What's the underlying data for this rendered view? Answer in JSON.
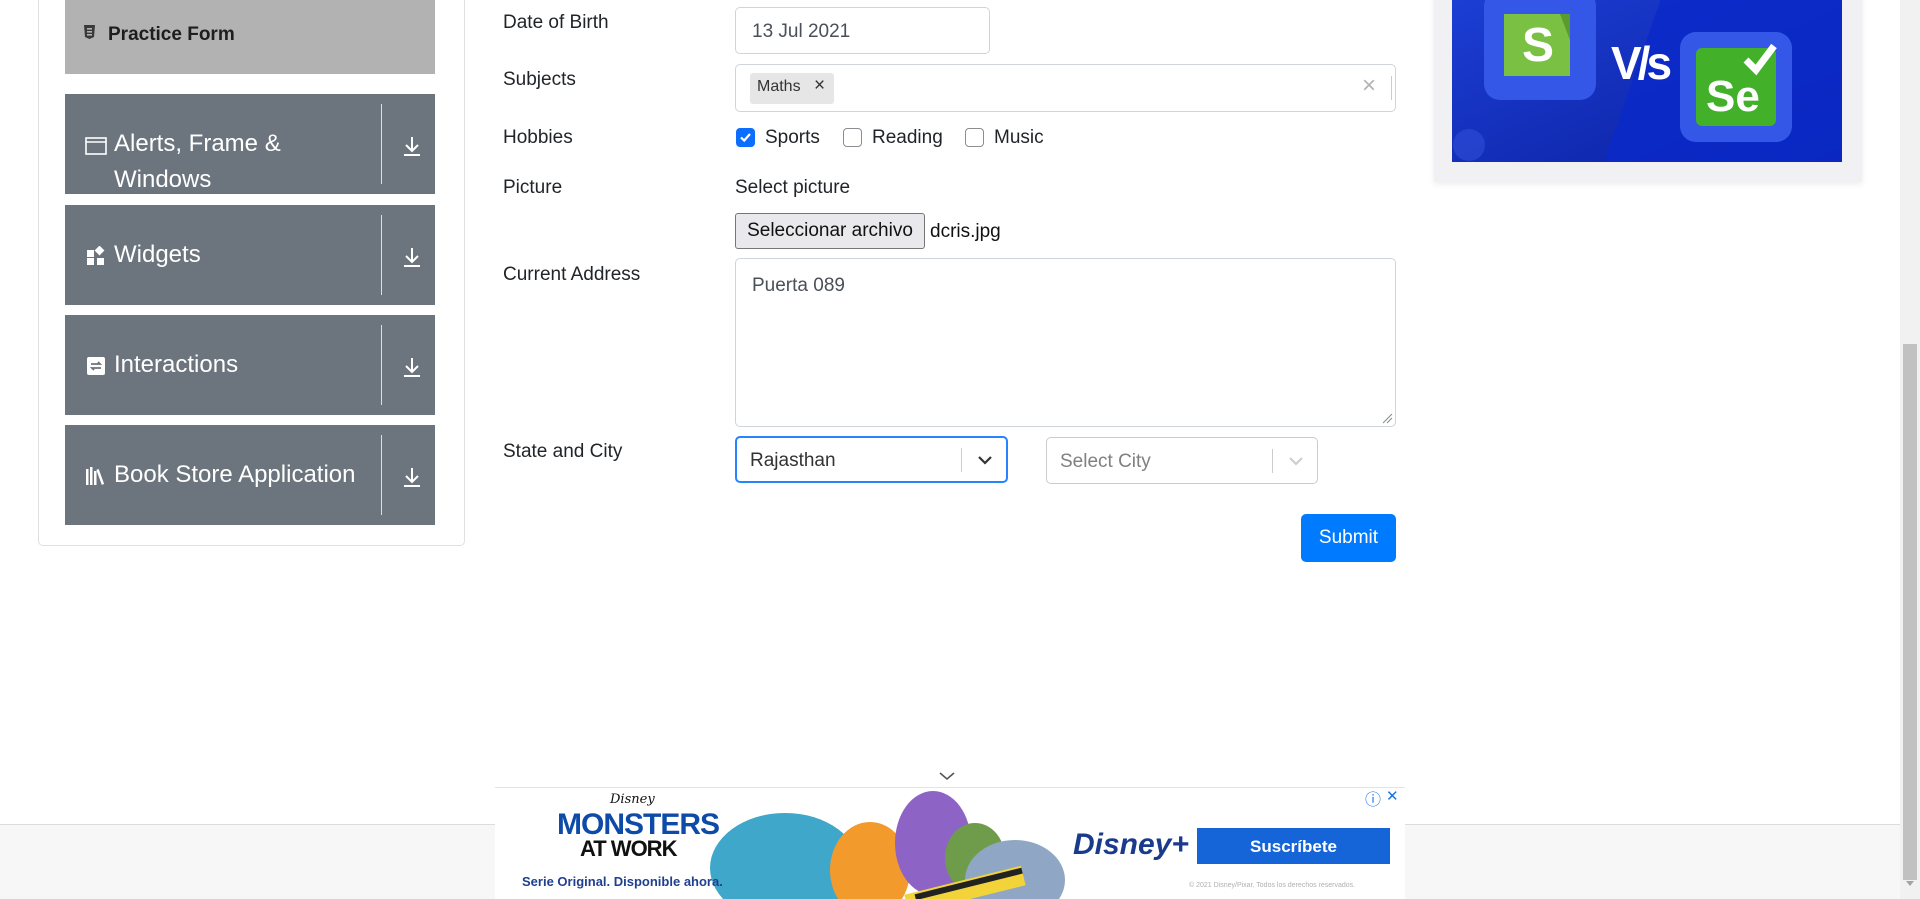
{
  "sidebar": {
    "active_item": "Practice Form",
    "groups": [
      {
        "label_line1": "Alerts, Frame &",
        "label_line2": "Windows",
        "icon": "window-icon"
      },
      {
        "label": "Widgets",
        "icon": "widgets-icon"
      },
      {
        "label": "Interactions",
        "icon": "interactions-icon"
      },
      {
        "label": "Book Store Application",
        "icon": "books-icon"
      }
    ]
  },
  "form": {
    "dob_label": "Date of Birth",
    "dob_value": "13 Jul 2021",
    "subjects_label": "Subjects",
    "subject_chip": "Maths",
    "subject_chip_remove": "×",
    "subjects_clear": "×",
    "hobbies_label": "Hobbies",
    "hobbies": [
      {
        "label": "Sports",
        "checked": true
      },
      {
        "label": "Reading",
        "checked": false
      },
      {
        "label": "Music",
        "checked": false
      }
    ],
    "picture_label": "Picture",
    "select_picture": "Select picture",
    "file_button": "Seleccionar archivo",
    "file_name": "dcris.jpg",
    "address_label": "Current Address",
    "address_value": "Puerta 089",
    "state_city_label": "State and City",
    "state_value": "Rajasthan",
    "city_placeholder": "Select City",
    "submit": "Submit"
  },
  "ad_right": {
    "vs_text": "V/s",
    "s_logo": "S",
    "se_logo": "Se"
  },
  "ad_bottom": {
    "brand": "Disney",
    "title_line1": "MONSTERS",
    "title_line2": "AT WORK",
    "tagline": "Serie Original. Disponible ahora.",
    "service": "Disney+",
    "cta": "Suscríbete",
    "legal": "© 2021 Disney/Pixar. Todos los derechos reservados.",
    "info_icon": "ⓘ",
    "close_icon": "✕"
  },
  "colors": {
    "accent": "#007bff",
    "sidebar_group": "#6c757d",
    "sidebar_active": "#b2b2b2",
    "disney_blue": "#1565d8"
  }
}
